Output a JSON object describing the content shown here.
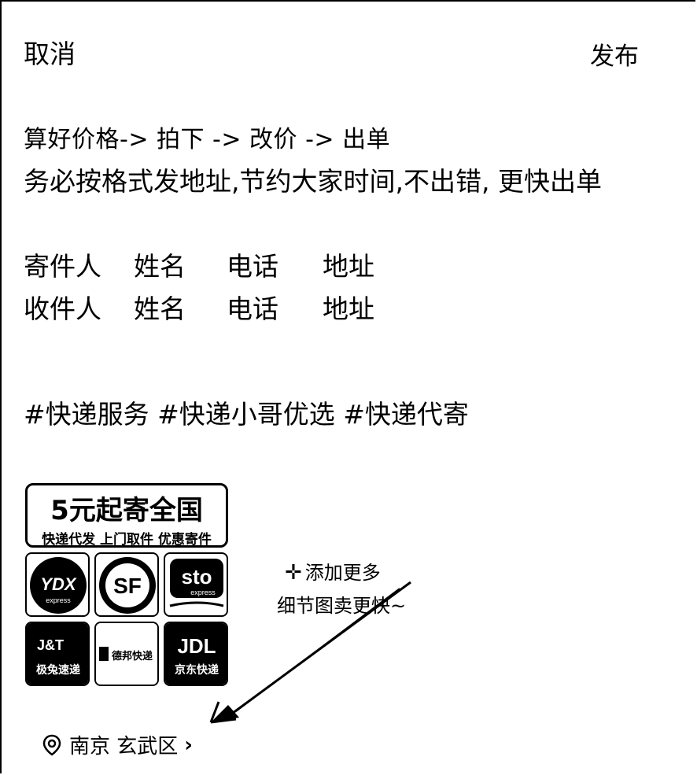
{
  "header": {
    "cancel_label": "取消",
    "publish_label": "发布"
  },
  "post": {
    "line1": "算好价格-> 拍下 -> 改价 -> 出单",
    "line2": "务必按格式发地址,节约大家时间,不出错, 更快出单",
    "sender": {
      "role": "寄件人",
      "name": "姓名",
      "phone": "电话",
      "address": "地址"
    },
    "receiver": {
      "role": "收件人",
      "name": "姓名",
      "phone": "电话",
      "address": "地址"
    },
    "hashtags": "#快递服务 #快递小哥优选 #快递代寄"
  },
  "image": {
    "banner_title": "5元起寄全国",
    "banner_subtitle": "快递代发 上门取件 优惠寄件",
    "logos": {
      "yd_text": "YDX",
      "yd_sub": "express",
      "sf_text": "SF",
      "sto_text": "sto",
      "sto_sub": "express",
      "jt_text": "J&T",
      "jt_sub": "极兔速递",
      "db_text": "德邦快递",
      "jdl_text": "JDL",
      "jdl_sub": "京东快递"
    }
  },
  "add_more": {
    "line1": "添加更多",
    "line2": "细节图卖更快~"
  },
  "location": {
    "label": "南京 玄武区"
  },
  "colors": {
    "text": "#000000",
    "background": "#ffffff"
  }
}
